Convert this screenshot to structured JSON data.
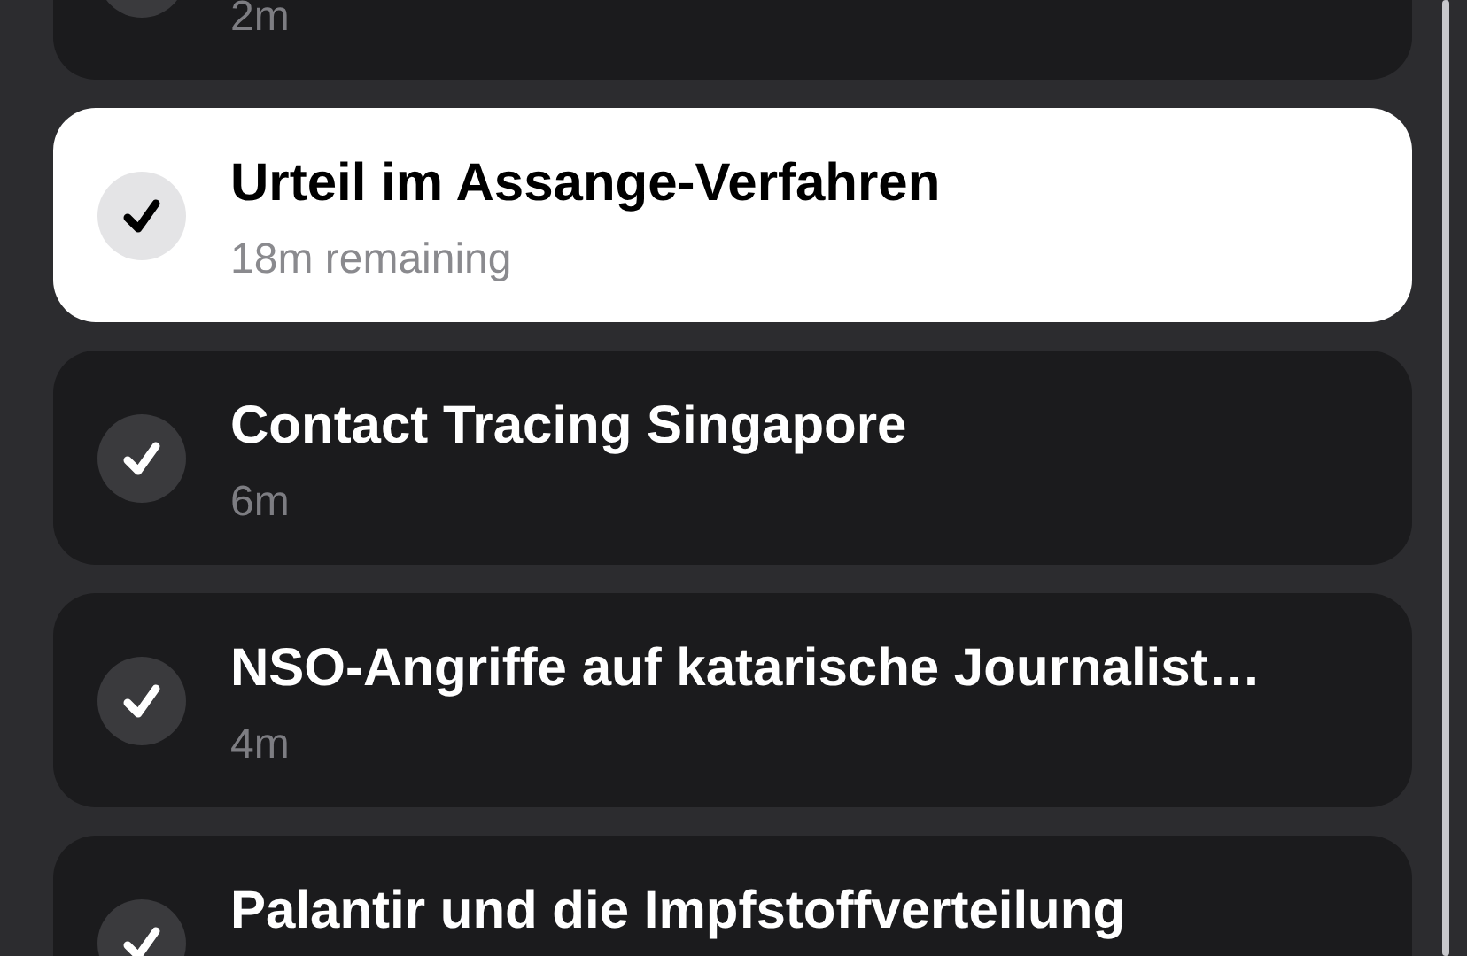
{
  "episodes": [
    {
      "duration": "2m",
      "selected": false
    },
    {
      "title": "Urteil im Assange-Verfahren",
      "duration": "18m remaining",
      "selected": true
    },
    {
      "title": "Contact Tracing Singapore",
      "duration": "6m",
      "selected": false
    },
    {
      "title": "NSO-Angriffe auf katarische Journalist…",
      "duration": "4m",
      "selected": false
    },
    {
      "title": "Palantir und die Impfstoffverteilung",
      "selected": false
    }
  ]
}
